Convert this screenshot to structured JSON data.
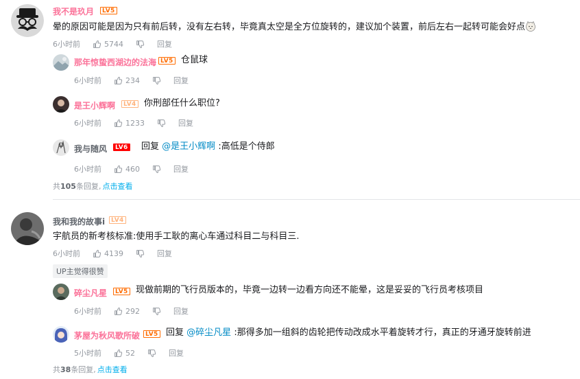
{
  "comments": [
    {
      "username": "我不是玖月",
      "level": "LV5",
      "text": "晕的原因可能是因为只有前后转，没有左右转，毕竟真太空是全方位旋转的，建议加个装置，前后左右一起转可能会好点",
      "time": "6小时前",
      "likes": "5744",
      "reply_label": "回复",
      "replies": [
        {
          "username": "那年惊蛰西湖边的法海",
          "level": "LV5",
          "text": "仓鼠球",
          "time": "6小时前",
          "likes": "234",
          "reply_label": "回复"
        },
        {
          "username": "是王小辉啊",
          "level": "LV4",
          "text": "你刑部任什么职位?",
          "time": "6小时前",
          "likes": "1233",
          "reply_label": "回复"
        },
        {
          "username": "我与随风",
          "level": "LV6",
          "reply_prefix": "回复",
          "reply_to": "@是王小辉啊",
          "text": ":高低是个侍郎",
          "time": "6小时前",
          "likes": "460",
          "reply_label": "回复"
        }
      ],
      "more": {
        "prefix": "共",
        "count": "105",
        "suffix": "条回复,",
        "link": "点击查看"
      }
    },
    {
      "username": "我和我的故事i",
      "level": "LV4",
      "text": "宇航员的新考核标准:使用手工耿的离心车通过科目二与科目三.",
      "time": "6小时前",
      "likes": "4139",
      "reply_label": "回复",
      "up_tag": "UP主觉得很赞",
      "replies": [
        {
          "username": "碎尘凡星",
          "level": "LV5",
          "text": "现做前期的飞行员版本的，毕竟一边转一边看方向还不能晕，这是妥妥的飞行员考核项目",
          "time": "6小时前",
          "likes": "292",
          "reply_label": "回复"
        },
        {
          "username": "茅屋为秋风歌所破",
          "level": "LV5",
          "reply_prefix": "回复",
          "reply_to": "@碎尘凡星",
          "text": ":那得多加一组斜的齿轮把传动改成水平着旋转才行，真正的牙通牙旋转前进",
          "time": "5小时前",
          "likes": "52",
          "reply_label": "回复"
        }
      ],
      "more": {
        "prefix": "共",
        "count": "38",
        "suffix": "条回复,",
        "link": "点击查看"
      }
    }
  ]
}
